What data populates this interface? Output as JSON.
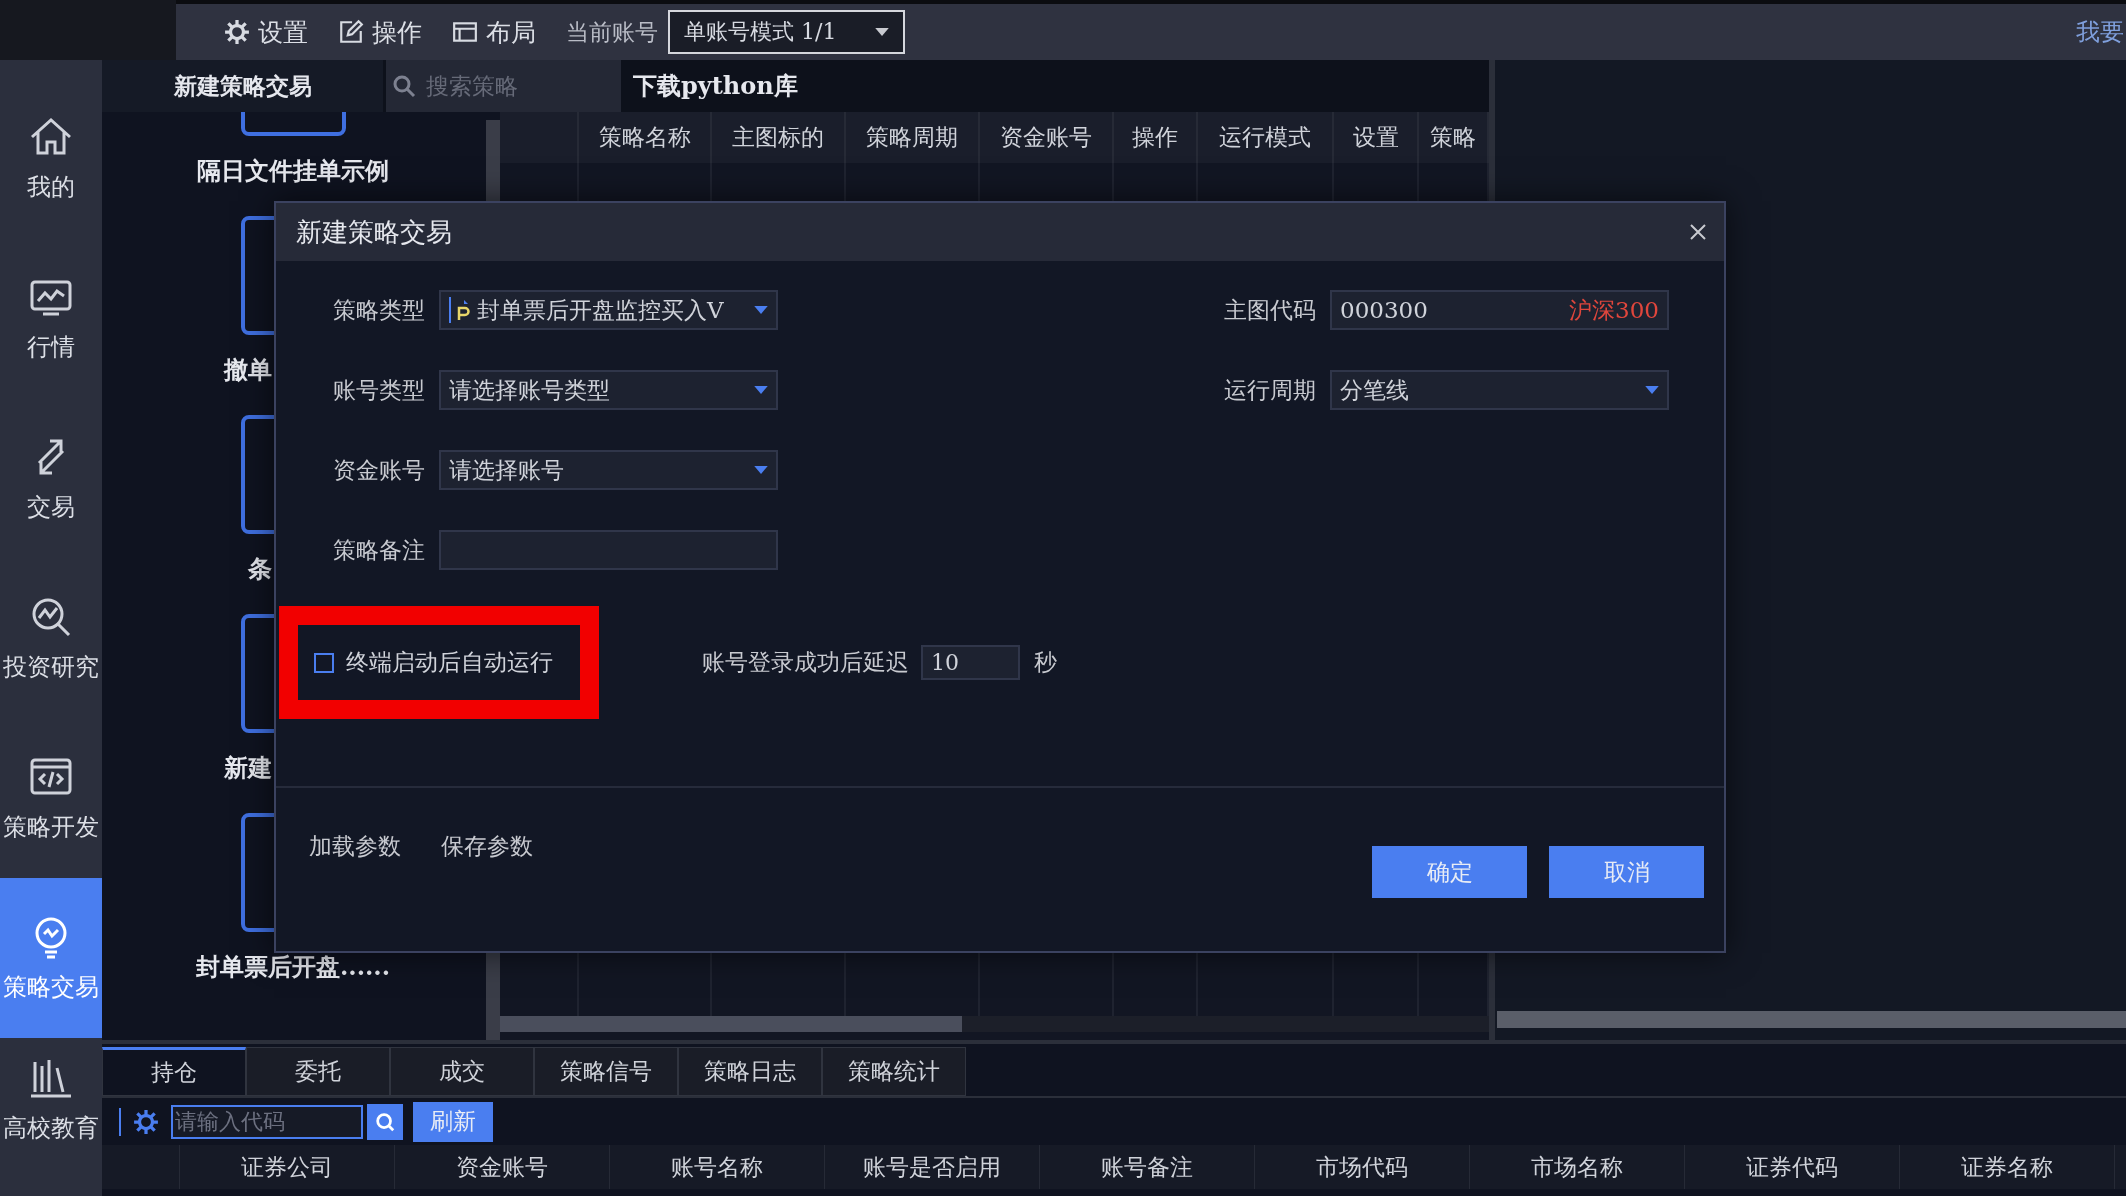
{
  "top_bar": {
    "menu": [
      {
        "label": "设置"
      },
      {
        "label": "操作"
      },
      {
        "label": "布局"
      }
    ],
    "account_label": "当前账号",
    "account_mode": "单账号模式 1/1",
    "open_account_link": "我要"
  },
  "sidebar": [
    {
      "label": "我的",
      "selected": false
    },
    {
      "label": "行情",
      "selected": false
    },
    {
      "label": "交易",
      "selected": false
    },
    {
      "label": "投资研究",
      "selected": false
    },
    {
      "label": "策略开发",
      "selected": false
    },
    {
      "label": "策略交易",
      "selected": true
    },
    {
      "label": "高校教育",
      "selected": false
    }
  ],
  "strategy_header": {
    "tab": "新建策略交易",
    "search_placeholder": "搜索策略",
    "download_link": "下载python库"
  },
  "strategy_cards": [
    {
      "label": "隔日文件挂单示例",
      "kind": "full"
    },
    {
      "label": "撤单",
      "kind": "partial"
    },
    {
      "label": "条",
      "kind": "partial"
    },
    {
      "label": "新建",
      "kind": "partial"
    },
    {
      "label": "封单票后开盘......",
      "kind": "full"
    }
  ],
  "strategy_table": {
    "columns": [
      "策略名称",
      "主图标的",
      "策略周期",
      "资金账号",
      "操作",
      "运行模式",
      "设置",
      "策略"
    ]
  },
  "dialog": {
    "title": "新建策略交易",
    "left_fields": [
      {
        "label": "策略类型",
        "kind": "strategy-select",
        "value": "封单票后开盘监控买入V"
      },
      {
        "label": "账号类型",
        "kind": "select",
        "value": "请选择账号类型"
      },
      {
        "label": "资金账号",
        "kind": "select",
        "value": "请选择账号"
      },
      {
        "label": "策略备注",
        "kind": "text"
      }
    ],
    "right_fields": [
      {
        "label": "主图代码",
        "kind": "code",
        "value": "000300",
        "name": "沪深300"
      },
      {
        "label": "运行周期",
        "kind": "select",
        "value": "分笔线"
      }
    ],
    "auto_run": {
      "label": "终端启动后自动运行",
      "checked": false,
      "highlighted": true
    },
    "delay": {
      "label": "账号登录成功后延迟",
      "value": "10",
      "unit": "秒"
    },
    "links": [
      "加载参数",
      "保存参数"
    ],
    "buttons": [
      "确定",
      "取消"
    ]
  },
  "bottom_panel": {
    "tabs": [
      {
        "label": "持仓",
        "selected": true
      },
      {
        "label": "委托",
        "selected": false
      },
      {
        "label": "成交",
        "selected": false
      },
      {
        "label": "策略信号",
        "selected": false
      },
      {
        "label": "策略日志",
        "selected": false
      },
      {
        "label": "策略统计",
        "selected": false
      }
    ],
    "code_placeholder": "请输入代码",
    "refresh_button": "刷新",
    "columns": [
      "证券公司",
      "资金账号",
      "账号名称",
      "账号是否启用",
      "账号备注",
      "市场代码",
      "市场名称",
      "证券代码",
      "证券名称"
    ]
  }
}
